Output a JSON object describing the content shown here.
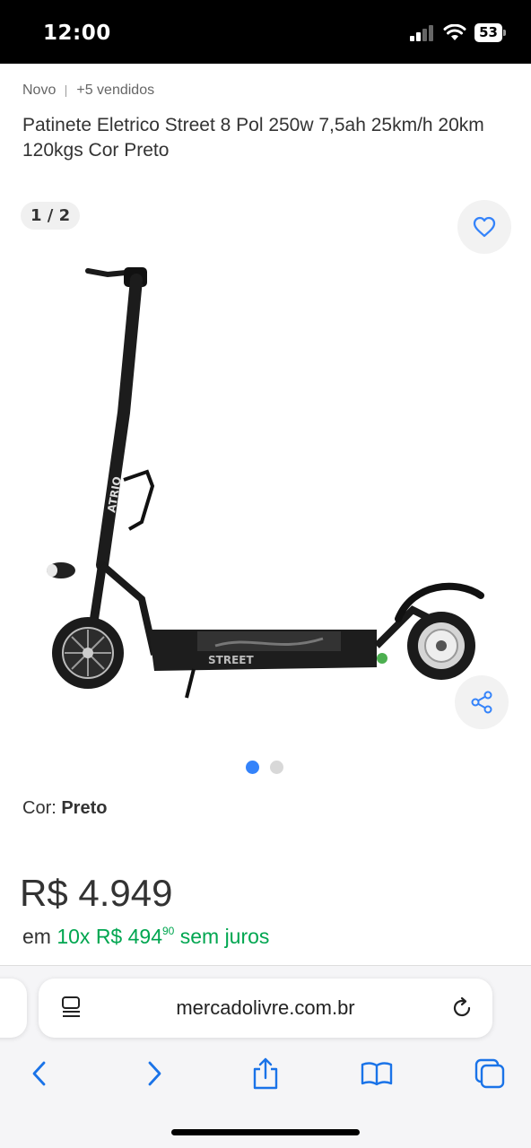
{
  "status": {
    "time": "12:00",
    "battery": "53"
  },
  "product": {
    "condition": "Novo",
    "sold": "+5 vendidos",
    "title": "Patinete Eletrico Street 8 Pol 250w 7,5ah 25km/h 20km 120kgs Cor Preto",
    "image_counter": "1 / 2",
    "image_brand_text": "ATRIO",
    "image_deck_text": "STREET",
    "color_label": "Cor: ",
    "color_value": "Preto",
    "price": "R$ 4.949",
    "install_prefix": "em ",
    "install_count": "10x R$ 494",
    "install_cents": "90",
    "install_suffix": " sem juros"
  },
  "gallery": {
    "total_images": 2,
    "active_index": 0
  },
  "browser": {
    "url": "mercadolivre.com.br"
  },
  "icons": {
    "favorite": "heart-icon",
    "share": "share-icon",
    "reader": "reader-icon",
    "reload": "reload-icon",
    "back": "chevron-left-icon",
    "forward": "chevron-right-icon",
    "share_sheet": "share-sheet-icon",
    "bookmarks": "book-icon",
    "tabs": "tabs-icon"
  },
  "colors": {
    "accent": "#3483fa",
    "green": "#00a650",
    "text": "#333333"
  }
}
